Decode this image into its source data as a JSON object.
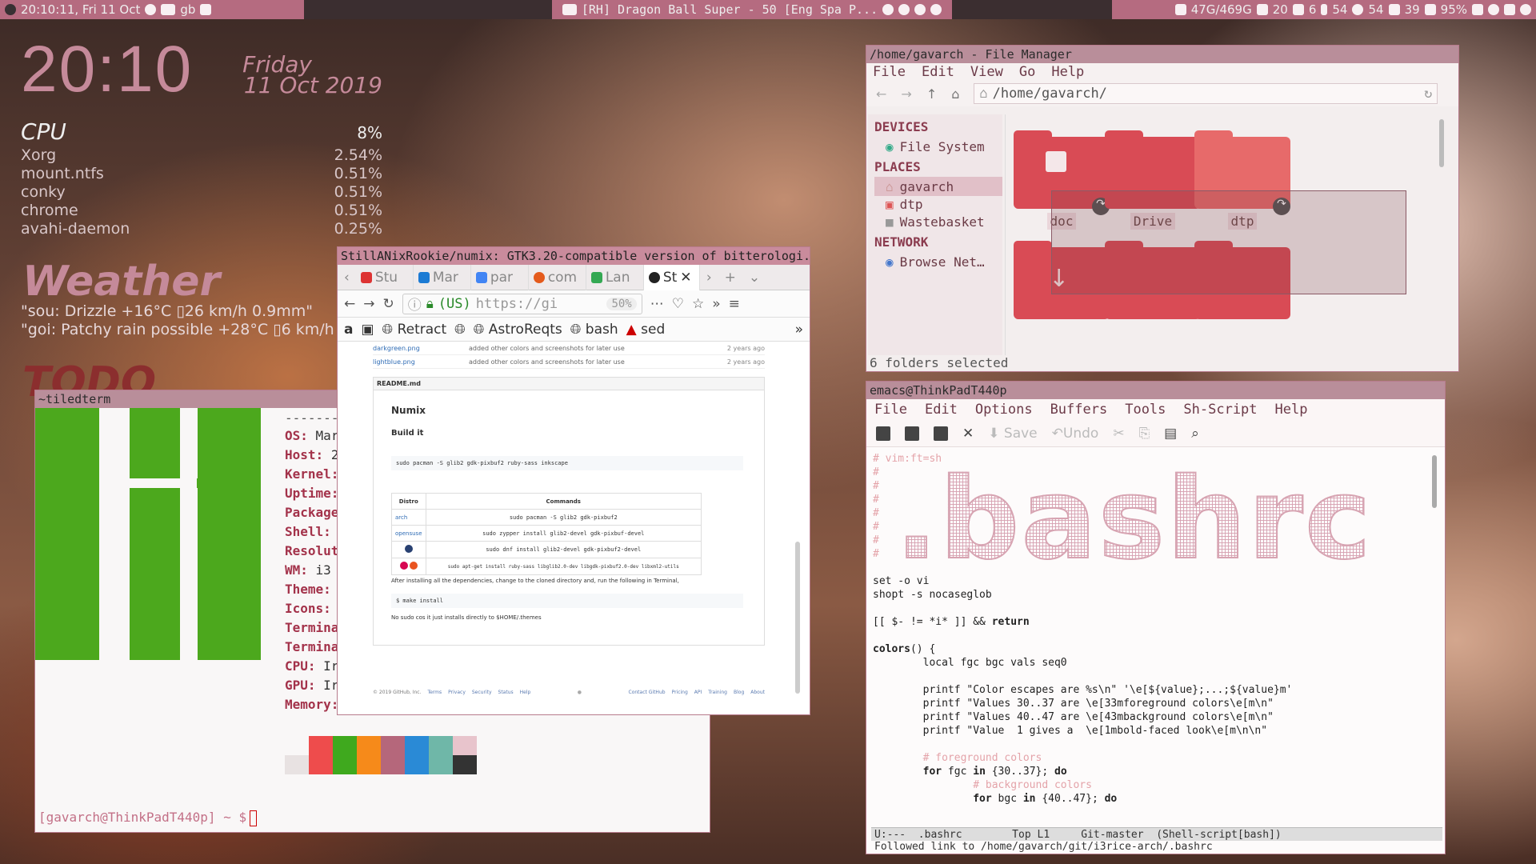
{
  "topbar": {
    "time": "20:10:11, Fri 11 Oct",
    "kbd": "gb",
    "media": "[RH] Dragon Ball Super - 50 [Eng Spa P...",
    "disk": "47G/469G",
    "mem": "20",
    "cpu": "6",
    "temp": "54",
    "fan": "54",
    "volume": "39",
    "battery": "95%"
  },
  "conky": {
    "clock": "20:10",
    "day": "Friday",
    "date": "11 Oct 2019",
    "cpu_title": "CPU",
    "cpu_pct": "8%",
    "procs": [
      {
        "name": "Xorg",
        "pct": "2.54%"
      },
      {
        "name": "mount.ntfs",
        "pct": "0.51%"
      },
      {
        "name": "conky",
        "pct": "0.51%"
      },
      {
        "name": "chrome",
        "pct": "0.51%"
      },
      {
        "name": "avahi-daemon",
        "pct": "0.25%"
      }
    ],
    "weather_title": "Weather",
    "weather_1": "\"sou: Drizzle +16°C ▯26 km/h 0.9mm\"",
    "weather_2": "\"goi: Patchy rain possible +28°C ▯6 km/h 0.",
    "todo_title": "TODO"
  },
  "terminal": {
    "title": "~tiledterm",
    "labels": [
      "OS:",
      "Host:",
      "Kernel:",
      "Uptime:",
      "Package",
      "Shell:",
      "Resolut",
      "WM:",
      "Theme:",
      "Icons:",
      "Termina",
      "Termina",
      "CPU:",
      "GPU:",
      "Memory:"
    ],
    "values": [
      "Mar",
      "2",
      "",
      "",
      "",
      "",
      "",
      "i3",
      "",
      "",
      "",
      "",
      "Ir",
      "Ir",
      ""
    ],
    "dashes": "--------",
    "prompt": "[gavarch@ThinkPadT440p] ~ $"
  },
  "browser": {
    "title": "StillANixRookie/numix: GTK3.20-compatible version of bitterologi...",
    "tabs": [
      "Stu",
      "Mar",
      "par",
      "com",
      "Lan",
      "St"
    ],
    "url": "https://gi",
    "country": "(US)",
    "zoom": "50%",
    "bookmarks": [
      "Retract",
      "AstroReqts",
      "bash",
      "sed"
    ],
    "files": [
      {
        "name": "darkgreen.png",
        "msg": "added other colors and screenshots for later use",
        "age": "2 years ago"
      },
      {
        "name": "lightblue.png",
        "msg": "added other colors and screenshots for later use",
        "age": "2 years ago"
      }
    ],
    "readme_label": "README.md",
    "h1": "Numix",
    "h2": "Build it",
    "cmd1": "sudo pacman -S glib2 gdk-pixbuf2 ruby-sass inkscape",
    "table_head": [
      "Distro",
      "Commands"
    ],
    "table_rows": [
      {
        "distro": "arch",
        "cmd": "sudo pacman -S glib2 gdk-pixbuf2"
      },
      {
        "distro": "opensuse",
        "cmd": "sudo zypper install glib2-devel gdk-pixbuf-devel"
      },
      {
        "distro": "",
        "cmd": "sudo dnf install glib2-devel gdk-pixbuf2-devel"
      },
      {
        "distro": "",
        "cmd": "sudo apt-get install ruby-sass libglib2.0-dev libgdk-pixbuf2.0-dev libxml2-utils"
      }
    ],
    "after_text": "After installing all the dependencies, change to the cloned directory and, run the following in Terminal,",
    "cmd2": "$ make install",
    "nosudo": "No sudo cos it just installs directly to $HOME/.themes",
    "footer_left": [
      "© 2019 GitHub, Inc.",
      "Terms",
      "Privacy",
      "Security",
      "Status",
      "Help"
    ],
    "footer_right": [
      "Contact GitHub",
      "Pricing",
      "API",
      "Training",
      "Blog",
      "About"
    ]
  },
  "filemanager": {
    "title": "/home/gavarch - File Manager",
    "menu": [
      "File",
      "Edit",
      "View",
      "Go",
      "Help"
    ],
    "path": "/home/gavarch/",
    "sections": [
      "DEVICES",
      "PLACES",
      "NETWORK"
    ],
    "devices": [
      "File System"
    ],
    "places": [
      "gavarch",
      "dtp",
      "Wastebasket"
    ],
    "network": [
      "Browse Net…"
    ],
    "folders": [
      "doc",
      "Drive",
      "dtp"
    ],
    "status": "6 folders selected"
  },
  "emacs": {
    "title": "emacs@ThinkPadT440p",
    "menu": [
      "File",
      "Edit",
      "Options",
      "Buffers",
      "Tools",
      "Sh-Script",
      "Help"
    ],
    "tools": [
      "Save",
      "Undo"
    ],
    "art": ".bashrc",
    "vim_line": "# vim:ft=sh",
    "modeline": "U:---  .bashrc        Top L1     Git-master  (Shell-script[bash])",
    "echo": "Followed link to /home/gavarch/git/i3rice-arch/.bashrc"
  },
  "colors": {
    "accent": "#c98b9c",
    "manjaro_green": "#4ca81d",
    "folder_red": "#d94b55"
  },
  "swatches": [
    "#e8e2e2",
    "#ee4c4c",
    "#3fa91e",
    "#f68a1a",
    "#b5677b",
    "#2a8ad6",
    "#6fb7a8",
    "#e8c4cc",
    "#333333"
  ]
}
